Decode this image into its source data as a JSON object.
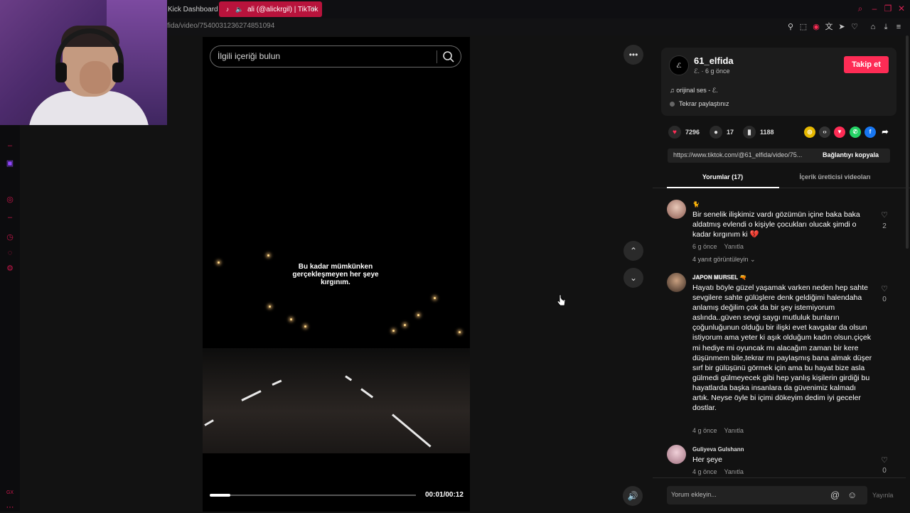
{
  "browser": {
    "tabs": [
      {
        "label": "Kick Dashboard"
      },
      {
        "label": "ali (@alickrgil) | TikTok"
      }
    ],
    "new_tab": "+",
    "url": "fida/video/7540031236274851094",
    "window_controls": [
      "search-icon",
      "minimize-icon",
      "restore-icon",
      "close-icon"
    ]
  },
  "video": {
    "search_placeholder": "İlgili içeriği bulun",
    "caption": "Bu kadar mümkünken gerçekleşmeyen her şeye kırgınım.",
    "progress": 0.1,
    "time": "00:01/00:12"
  },
  "author": {
    "avatar_text": "ℰ.",
    "username": "61_elfida",
    "meta": "ℰ. · 6 g önce",
    "follow": "Takip et",
    "music": "♫  orijinal ses - ℰ.",
    "shared": "Tekrar paylaştınız"
  },
  "stats": {
    "likes": "7296",
    "comments": "17",
    "saves": "1188"
  },
  "link": {
    "url": "https://www.tiktok.com/@61_elfida/video/75...",
    "copy": "Bağlantıyı kopyala"
  },
  "tabs": {
    "comments": "Yorumlar (17)",
    "creator": "İçerik üreticisi videoları"
  },
  "comments": [
    {
      "user": "🐈",
      "text": "Bir senelik ilişkimiz vardı gözümün içine baka baka aldatmış evlendi o kişiyle çocukları olucak şimdi o kadar kırgınım ki 💔",
      "time": "6 g önce",
      "reply": "Yanıtla",
      "likes": "2",
      "replies": "4 yanıt görüntüleyin ⌄"
    },
    {
      "user": "𝐉𝐀𝐏𝐎𝐍 𝐌𝐔𝐑𝐒𝐄𝐋 🔫",
      "text": "Hayatı böyle güzel yaşamak varken neden hep sahte sevgilere sahte gülüşlere denk geldiğimi halendaha anlamış değilim çok da bir şey istemiyorum aslında..güven sevgi saygı mutluluk bunların çoğunluğunun olduğu bir ilişki evet kavgalar da olsun istiyorum ama yeter ki aşık olduğum kadın olsun.çiçek mi hediye mi oyuncak mı alacağım zaman bir kere düşünmem bile,tekrar mı paylaşmış bana almak düşer sırf bir gülüşünü görmek için ama bu hayat bize asla gülmedi gülmeyecek gibi hep yanlış kişilerin girdiği bu hayatlarda başka insanlara da güvenimiz kalmadı artık. Neyse öyle bi içimi dökeyim dedim iyi geceler dostlar.",
      "time": "4 g önce",
      "reply": "Yanıtla",
      "likes": "0"
    },
    {
      "user": "Guliyeva Gulshann",
      "text": "Her şeye",
      "time": "4 g önce",
      "reply": "Yanıtla",
      "likes": "0"
    }
  ],
  "comment_bar": {
    "placeholder": "Yorum ekleyin...",
    "post": "Yayınla"
  },
  "colors": {
    "accent": "#fe2c55",
    "brand_tab": "#b8133c",
    "sidebar_icon": "#c8164a"
  }
}
